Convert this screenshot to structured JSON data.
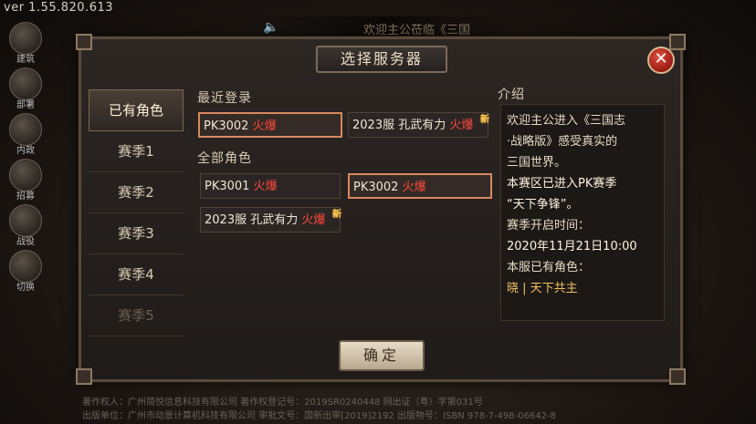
{
  "version": "ver 1.55.820.613",
  "banner": {
    "text": "欢迎主公莅临《三国"
  },
  "left_icons": [
    {
      "label": "建筑"
    },
    {
      "label": "部署"
    },
    {
      "label": "内政"
    },
    {
      "label": "招募"
    },
    {
      "label": "战役"
    },
    {
      "label": "切换"
    }
  ],
  "dialog": {
    "title": "选择服务器",
    "tabs": [
      "已有角色",
      "赛季1",
      "赛季2",
      "赛季3",
      "赛季4",
      "赛季5"
    ],
    "recent_label": "最近登录",
    "all_label": "全部角色",
    "recent_servers": [
      {
        "name": "PK3002",
        "status": "火爆",
        "selected": true,
        "new": false
      },
      {
        "name": "2023服 孔武有力",
        "status": "火爆",
        "selected": false,
        "new": true
      }
    ],
    "all_servers": [
      {
        "name": "PK3001",
        "status": "火爆",
        "selected": false,
        "new": false
      },
      {
        "name": "PK3002",
        "status": "火爆",
        "selected": true,
        "new": false
      },
      {
        "name": "2023服 孔武有力",
        "status": "火爆",
        "selected": false,
        "new": true
      }
    ],
    "new_badge": "新",
    "intro_label": "介绍",
    "intro": {
      "line1": "欢迎主公进入《三国志",
      "line2": "·战略版》感受真实的",
      "line3": "三国世界。",
      "line4": "本赛区已进入PK赛季",
      "line5": "“天下争锋”。",
      "line6": "赛季开启时间：",
      "line7": "2020年11月21日10:00",
      "line8": "本服已有角色：",
      "line9": "晓 | 天下共主"
    },
    "ok_label": "确定"
  },
  "copyright": {
    "line1": "著作权人：广州简悦信息科技有限公司    著作权登记号：2019SR0240448        网出证（粤）字第031号",
    "line2": "出版单位：广州市动景计算机科技有限公司 审批文号：国新出审[2019]2192    出版物号：ISBN 978-7-498-06642-8"
  }
}
